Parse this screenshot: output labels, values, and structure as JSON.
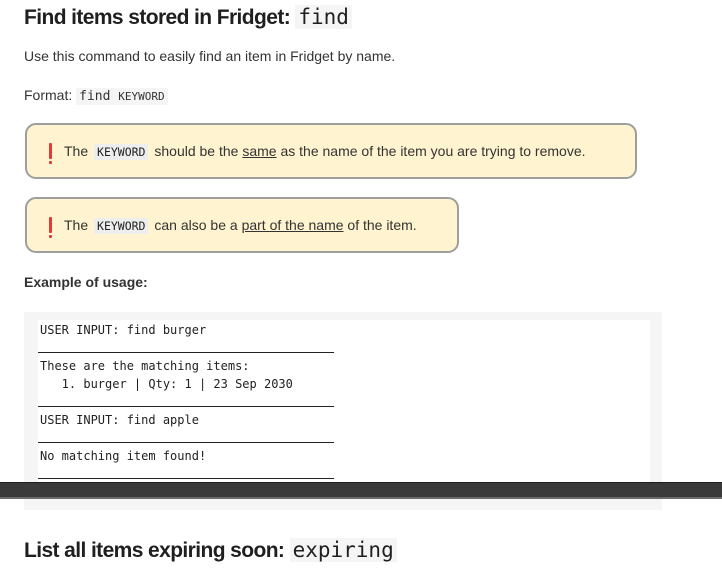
{
  "sections": {
    "find": {
      "title": "Find items stored in Fridget: ",
      "command": "find",
      "intro": "Use this command to easily find an item in Fridget by name.",
      "format_label": "Format:",
      "format_command": "find",
      "format_keyword": "KEYWORD"
    },
    "expiring": {
      "title": "List all items expiring soon: ",
      "command": "expiring"
    }
  },
  "callouts": [
    {
      "pre": "The",
      "keyword": "KEYWORD",
      "mid": "should be the",
      "underlined": "same",
      "post": "as the name of the item you are trying to remove."
    },
    {
      "pre": "The",
      "keyword": "KEYWORD",
      "mid": "can also be a",
      "underlined": "part of the name",
      "post": "of the item."
    }
  ],
  "example": {
    "heading": "Example of usage:",
    "lines": [
      "USER INPUT: find burger",
      "These are the matching items:",
      "   1. burger | Qty: 1 | 23 Sep 2030",
      "USER INPUT: find apple",
      "No matching item found!"
    ]
  },
  "colors": {
    "callout_bg": "#fff4cf",
    "callout_border": "#9e9e9e",
    "warning_icon": "#e53935",
    "code_bg": "#f5f5f5"
  },
  "icons": {
    "callout": "exclamation-icon"
  }
}
